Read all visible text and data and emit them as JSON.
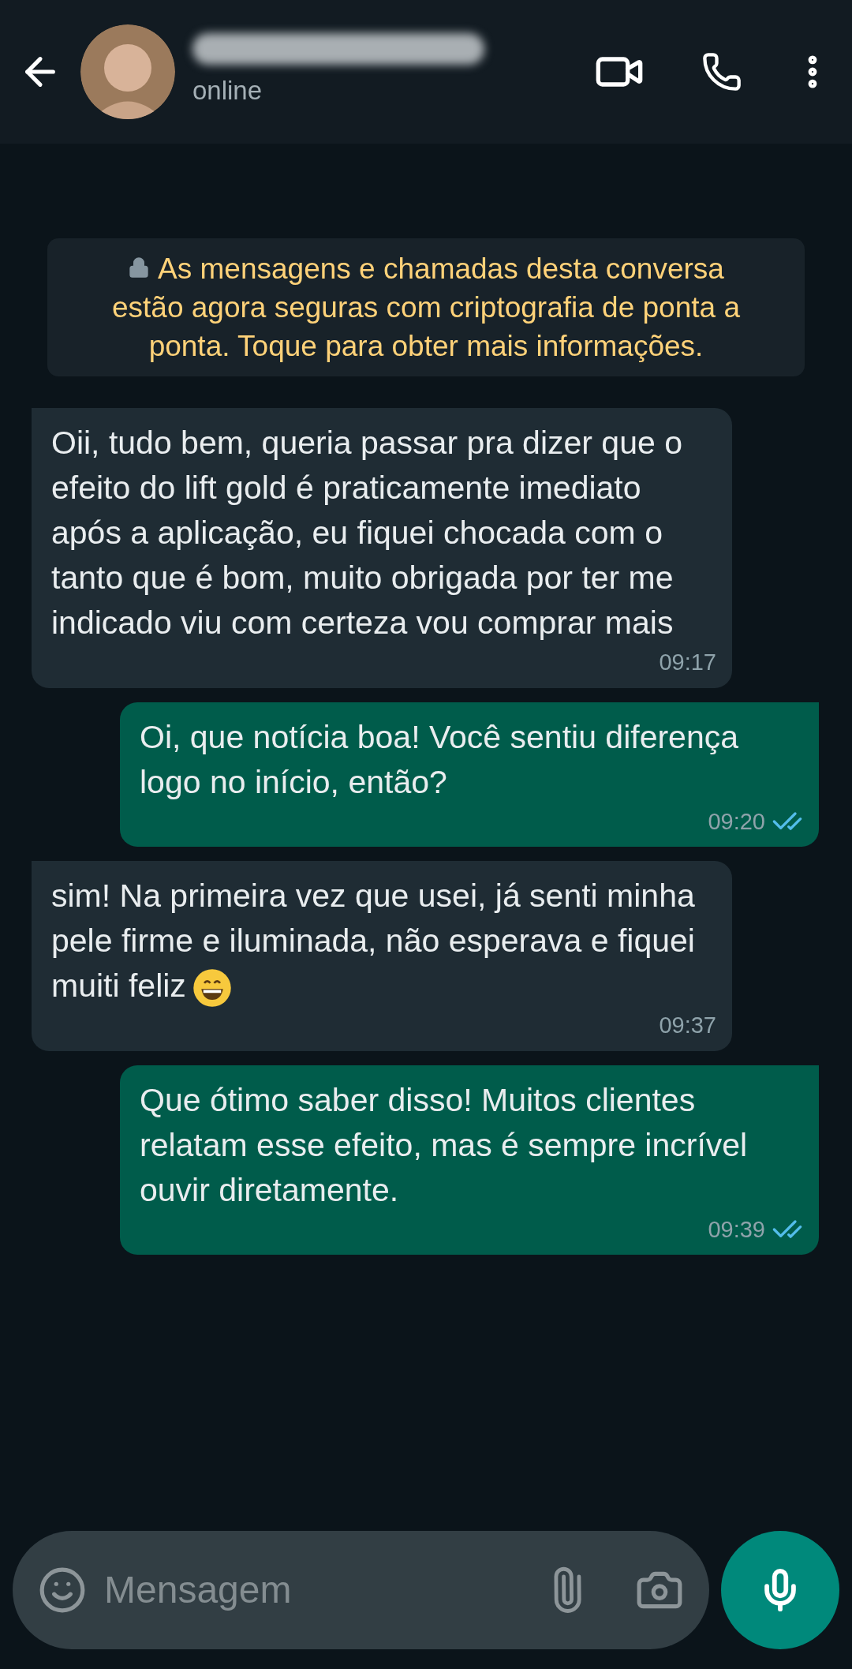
{
  "header": {
    "status": "online"
  },
  "notice": {
    "text": "As mensagens e chamadas desta conversa estão agora seguras com criptografia de ponta a ponta. Toque para obter mais informações."
  },
  "messages": [
    {
      "kind": "incoming",
      "text": "Oii, tudo bem, queria passar pra dizer que o efeito do lift gold é praticamente imediato após a aplicação, eu fiquei chocada com o tanto que é bom, muito obrigada por ter me indicado viu com certeza vou comprar mais",
      "time": "09:17"
    },
    {
      "kind": "outgoing",
      "text": "Oi, que notícia boa! Você sentiu diferença logo no início, então?",
      "time": "09:20",
      "read": true
    },
    {
      "kind": "incoming",
      "text": "sim! Na primeira vez que usei, já senti minha pele firme e iluminada, não esperava e fiquei muiti feliz",
      "time": "09:37",
      "emoji": true
    },
    {
      "kind": "outgoing",
      "text": "Que ótimo saber disso! Muitos clientes relatam esse efeito, mas é sempre incrível ouvir diretamente.",
      "time": "09:39",
      "read": true
    }
  ],
  "composer": {
    "placeholder": "Mensagem"
  }
}
